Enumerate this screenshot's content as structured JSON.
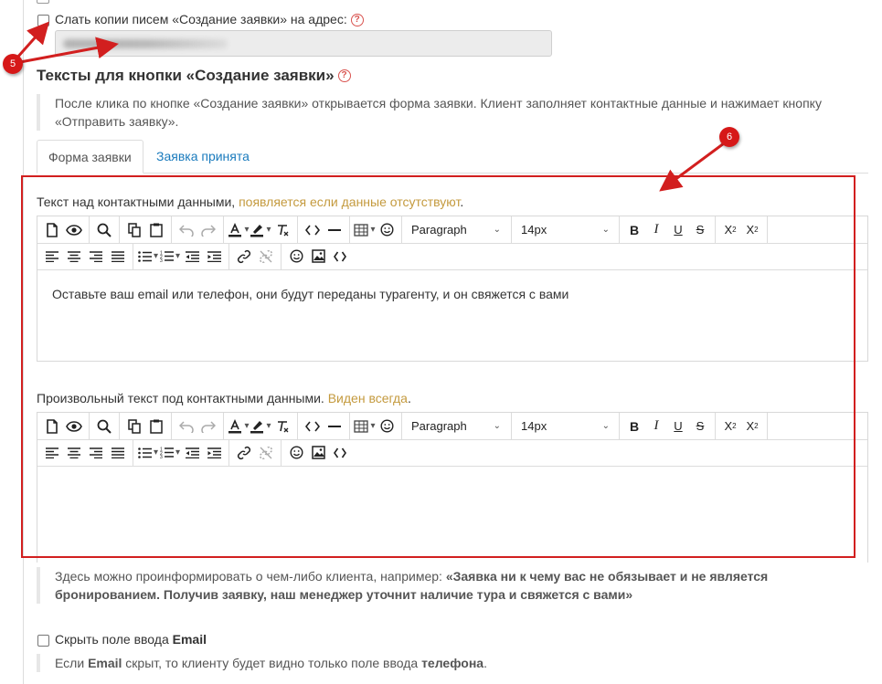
{
  "copy_option": {
    "label": "Слать копии писем «Создание заявки» на адрес:",
    "help": "?",
    "email_value": ""
  },
  "section": {
    "title": "Тексты для кнопки «Создание заявки»",
    "help": "?",
    "description": "После клика по кнопке «Создание заявки» открывается форма заявки. Клиент заполняет контактные данные и нажимает кнопку «Отправить заявку»."
  },
  "tabs": [
    {
      "label": "Форма заявки",
      "active": true
    },
    {
      "label": "Заявка принята",
      "active": false
    }
  ],
  "editor1": {
    "label_main": "Текст над контактными данными, ",
    "label_note": "появляется если данные отсутствуют",
    "label_end": ".",
    "paragraph_select": "Paragraph",
    "size_select": "14px",
    "content": "Оставьте ваш email или телефон, они будут переданы турагенту, и он свяжется с вами"
  },
  "editor2": {
    "label_main": "Произвольный текст под контактными данными. ",
    "label_note": "Виден всегда",
    "label_end": ".",
    "paragraph_select": "Paragraph",
    "size_select": "14px",
    "content": ""
  },
  "info_note": {
    "prefix": "Здесь можно проинформировать о чем-либо клиента, например: ",
    "bold": "«Заявка ни к чему вас не обязывает и не является бронированием. Получив заявку, наш менеджер уточнит наличие тура и свяжется с вами»"
  },
  "hide_email": {
    "label_prefix": "Скрыть поле ввода ",
    "label_bold": "Email",
    "note_1": "Если ",
    "note_bold_1": "Email",
    "note_2": " скрыт, то клиенту будет видно только поле ввода ",
    "note_bold_2": "телефона",
    "note_3": "."
  },
  "annotations": {
    "badge_5": "5",
    "badge_6": "6",
    "color_red": "#d21f1f",
    "color_link": "#1a7bbd",
    "color_orange": "#c49a3e"
  }
}
